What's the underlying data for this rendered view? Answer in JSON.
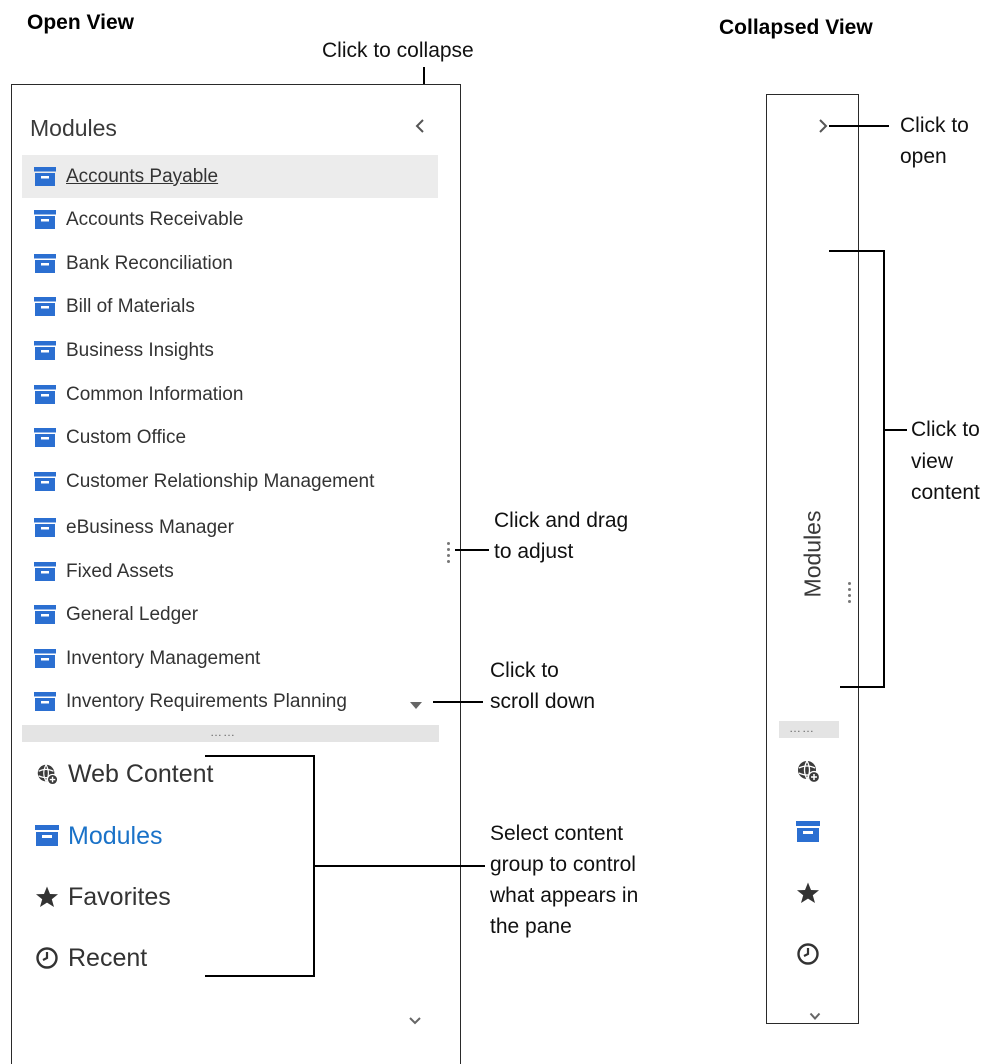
{
  "open_view": {
    "heading": "Open View",
    "pane_title": "Modules",
    "modules": [
      {
        "label": "Accounts Payable",
        "selected": true
      },
      {
        "label": "Accounts Receivable"
      },
      {
        "label": "Bank Reconciliation"
      },
      {
        "label": "Bill of Materials"
      },
      {
        "label": "Business Insights"
      },
      {
        "label": "Common Information"
      },
      {
        "label": "Custom Office"
      },
      {
        "label": "Customer Relationship Management"
      },
      {
        "label": "eBusiness Manager"
      },
      {
        "label": "Fixed Assets"
      },
      {
        "label": "General Ledger"
      },
      {
        "label": "Inventory Management"
      },
      {
        "label": "Inventory Requirements Planning"
      }
    ],
    "groups": [
      {
        "label": "Web Content",
        "icon": "globe-icon"
      },
      {
        "label": "Modules",
        "icon": "module-icon",
        "active": true
      },
      {
        "label": "Favorites",
        "icon": "star-icon"
      },
      {
        "label": "Recent",
        "icon": "clock-icon"
      }
    ]
  },
  "collapsed_view": {
    "heading": "Collapsed View",
    "vertical_label": "Modules"
  },
  "callouts": {
    "collapse": "Click to collapse",
    "drag_line1": "Click and drag",
    "drag_line2": "to adjust",
    "scroll_line1": "Click to",
    "scroll_line2": "scroll down",
    "select_line1": "Select content",
    "select_line2": "group to control",
    "select_line3": "what appears in",
    "select_line4": "the pane",
    "open_line1": "Click to",
    "open_line2": "open",
    "view_line1": "Click to",
    "view_line2": "view",
    "view_line3": "content"
  },
  "colors": {
    "accent": "#1a72c8",
    "module_icon": "#2b6fd1",
    "selected_bg": "#ececec"
  }
}
